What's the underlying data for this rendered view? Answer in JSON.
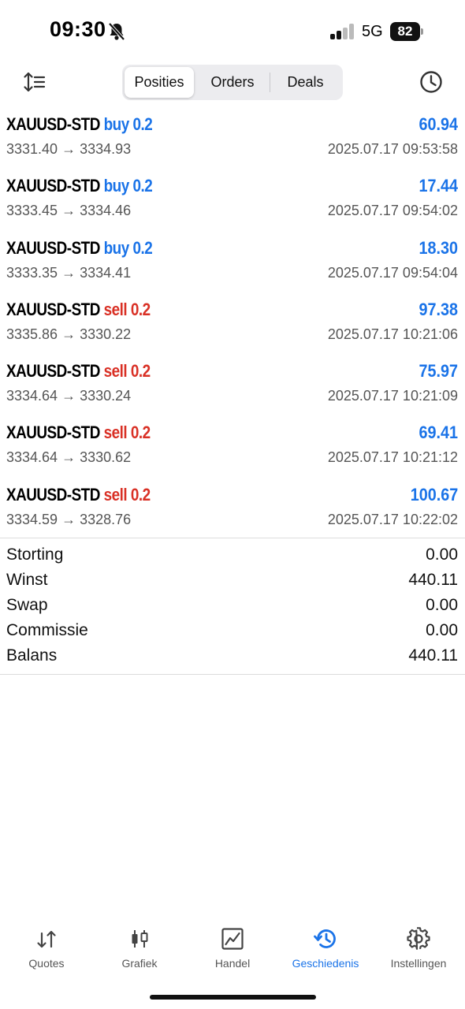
{
  "status": {
    "time": "09:30",
    "network": "5G",
    "battery": "82"
  },
  "header": {
    "tabs": [
      {
        "label": "Posities",
        "active": true
      },
      {
        "label": "Orders",
        "active": false
      },
      {
        "label": "Deals",
        "active": false
      }
    ],
    "sort_icon": "sort-icon",
    "history_icon": "clock-icon"
  },
  "colors": {
    "buy": "#1a73e8",
    "sell": "#d93025",
    "profit": "#1a73e8",
    "accent": "#1a73e8"
  },
  "deals": [
    {
      "symbol": "XAUUSD-STD",
      "dir": "buy 0.2",
      "side": "buy",
      "profit": "60.94",
      "prices": "3331.40 → 3334.93",
      "time": "2025.07.17 09:53:58"
    },
    {
      "symbol": "XAUUSD-STD",
      "dir": "buy 0.2",
      "side": "buy",
      "profit": "17.44",
      "prices": "3333.45 → 3334.46",
      "time": "2025.07.17 09:54:02"
    },
    {
      "symbol": "XAUUSD-STD",
      "dir": "buy 0.2",
      "side": "buy",
      "profit": "18.30",
      "prices": "3333.35 → 3334.41",
      "time": "2025.07.17 09:54:04"
    },
    {
      "symbol": "XAUUSD-STD",
      "dir": "sell 0.2",
      "side": "sell",
      "profit": "97.38",
      "prices": "3335.86 → 3330.22",
      "time": "2025.07.17 10:21:06"
    },
    {
      "symbol": "XAUUSD-STD",
      "dir": "sell 0.2",
      "side": "sell",
      "profit": "75.97",
      "prices": "3334.64 → 3330.24",
      "time": "2025.07.17 10:21:09"
    },
    {
      "symbol": "XAUUSD-STD",
      "dir": "sell 0.2",
      "side": "sell",
      "profit": "69.41",
      "prices": "3334.64 → 3330.62",
      "time": "2025.07.17 10:21:12"
    },
    {
      "symbol": "XAUUSD-STD",
      "dir": "sell 0.2",
      "side": "sell",
      "profit": "100.67",
      "prices": "3334.59 → 3328.76",
      "time": "2025.07.17 10:22:02"
    }
  ],
  "summary": [
    {
      "label": "Storting",
      "value": "0.00"
    },
    {
      "label": "Winst",
      "value": "440.11"
    },
    {
      "label": "Swap",
      "value": "0.00"
    },
    {
      "label": "Commissie",
      "value": "0.00"
    },
    {
      "label": "Balans",
      "value": "440.11"
    }
  ],
  "tabbar": [
    {
      "label": "Quotes",
      "icon": "quotes-icon",
      "active": false
    },
    {
      "label": "Grafiek",
      "icon": "chart-icon",
      "active": false
    },
    {
      "label": "Handel",
      "icon": "trade-icon",
      "active": false
    },
    {
      "label": "Geschiedenis",
      "icon": "history-icon",
      "active": true
    },
    {
      "label": "Instellingen",
      "icon": "settings-icon",
      "active": false
    }
  ]
}
